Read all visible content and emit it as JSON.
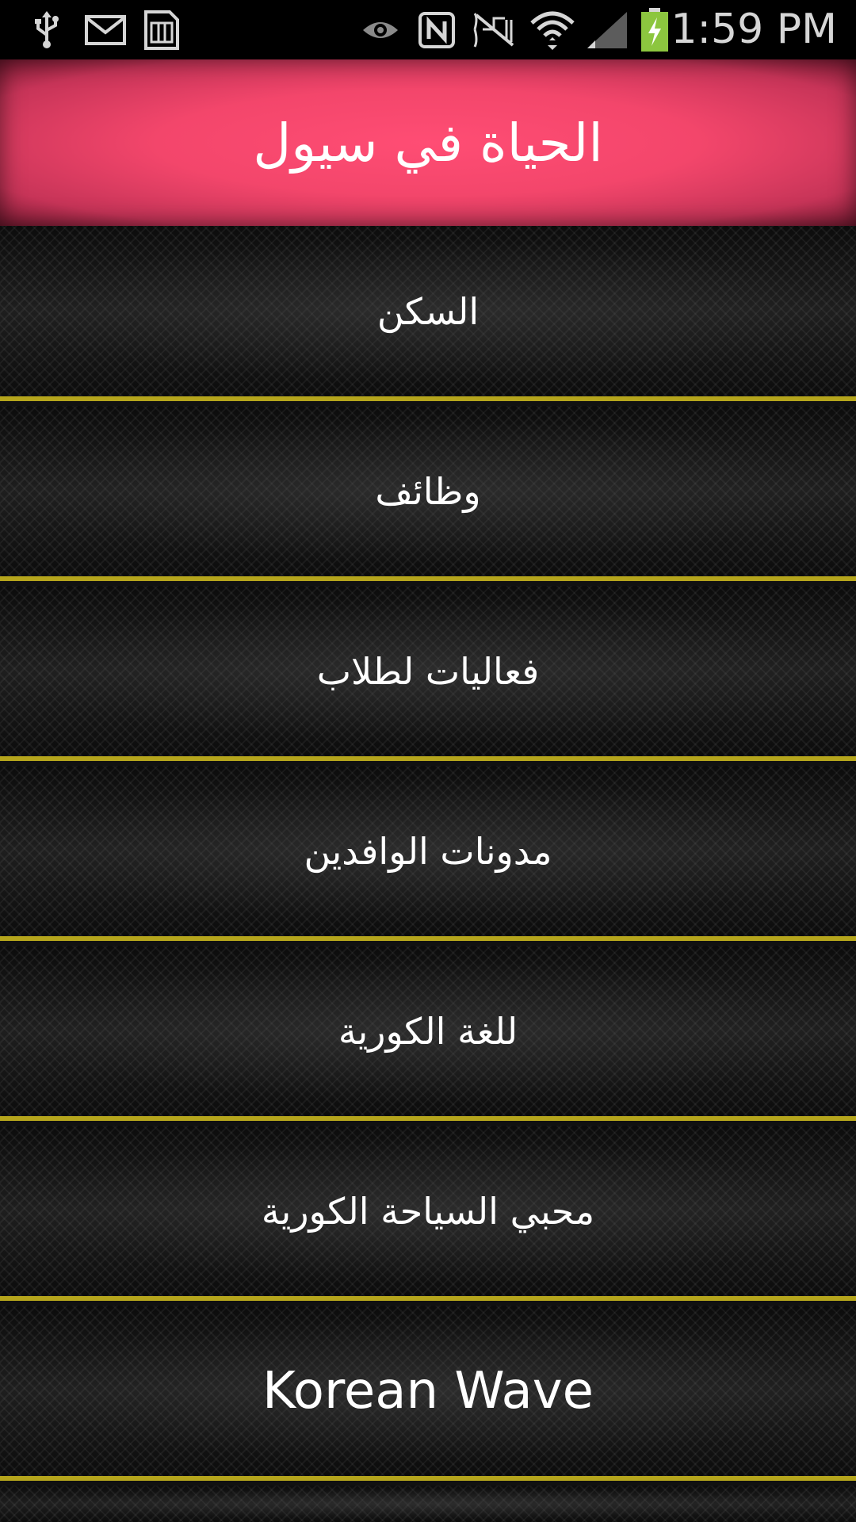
{
  "status_bar": {
    "time": "1:59 PM",
    "icons": [
      "usb-icon",
      "gmail-icon",
      "sim-card-icon",
      "eye-icon",
      "nfc-icon",
      "mute-icon",
      "wifi-icon",
      "signal-icon",
      "battery-charging-icon"
    ]
  },
  "header": {
    "title": "الحياة في سيول"
  },
  "menu": {
    "items": [
      {
        "label": "السكن"
      },
      {
        "label": "وظائف"
      },
      {
        "label": "فعاليات لطلاب"
      },
      {
        "label": "مدونات الوافدين"
      },
      {
        "label": "للغة الكورية"
      },
      {
        "label": "محبي السياحة الكورية"
      },
      {
        "label": "Korean Wave"
      }
    ]
  },
  "colors": {
    "header_accent": "#f3466b",
    "divider": "#b5a51c",
    "battery": "#8cc63f"
  }
}
